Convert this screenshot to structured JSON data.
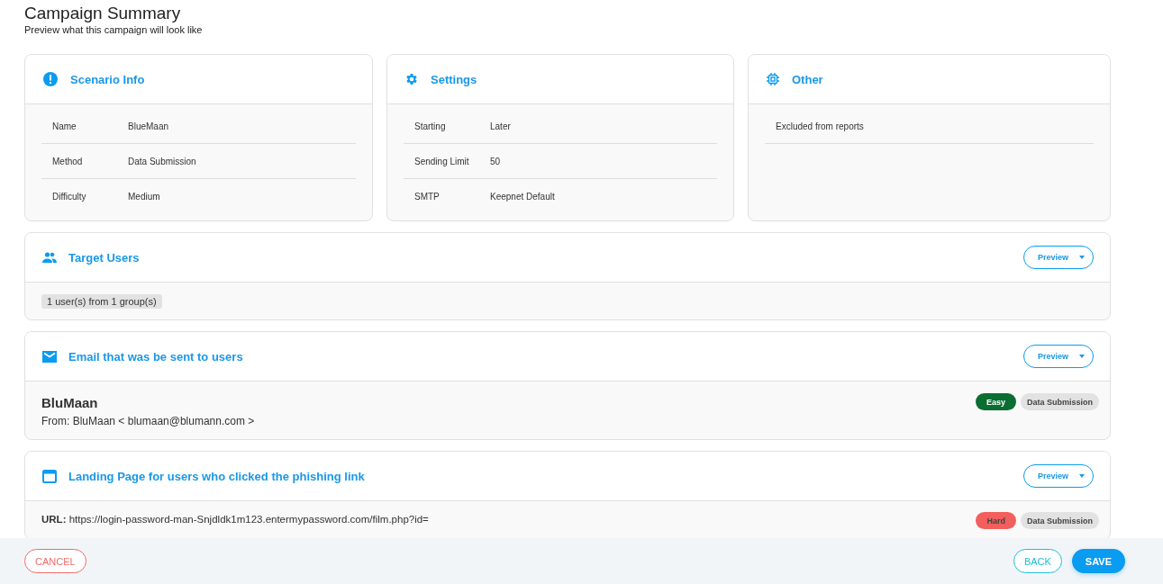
{
  "header": {
    "title": "Campaign Summary",
    "subtitle": "Preview what this campaign will look like"
  },
  "info_cards": [
    {
      "kind": "info",
      "title": "Scenario Info",
      "rows": [
        {
          "label": "Name",
          "value": "BlueMaan"
        },
        {
          "label": "Method",
          "value": "Data Submission"
        },
        {
          "label": "Difficulty",
          "value": "Medium"
        }
      ]
    },
    {
      "kind": "gear",
      "title": "Settings",
      "rows": [
        {
          "label": "Starting",
          "value": "Later"
        },
        {
          "label": "Sending Limit",
          "value": "50"
        },
        {
          "label": "SMTP",
          "value": "Keepnet Default"
        }
      ]
    },
    {
      "kind": "chip",
      "title": "Other",
      "rows": [
        {
          "label": "Excluded from reports"
        }
      ]
    }
  ],
  "sections": [
    {
      "kind": "users",
      "title": "Target Users",
      "button": "Preview",
      "body": {
        "kind": "chip",
        "text": "1 user(s) from 1 group(s)"
      }
    },
    {
      "kind": "email",
      "title": "Email that was be sent to users",
      "button": "Preview",
      "body": {
        "kind": "email",
        "name": "BluMaan",
        "from": "From: BluMaan < blumaan@blumann.com >",
        "tags": [
          {
            "text": "Easy",
            "color": "#0a6e31"
          },
          {
            "text": "Data Submission",
            "color": "#e2e2e2"
          }
        ]
      }
    },
    {
      "kind": "window",
      "title": "Landing Page for users who clicked the phishing link",
      "button": "Preview",
      "body": {
        "kind": "url",
        "text": "**URL:** https://login-password-man-Snjdldk1m123.entermypassword.com/film.php?id=",
        "tags": [
          {
            "text": "Hard",
            "color": "#f25f5c"
          },
          {
            "text": "Data Submission",
            "color": "#e2e2e2"
          }
        ]
      }
    }
  ],
  "footer": {
    "cancel": "CANCEL",
    "back": "BACK",
    "save": "SAVE"
  }
}
